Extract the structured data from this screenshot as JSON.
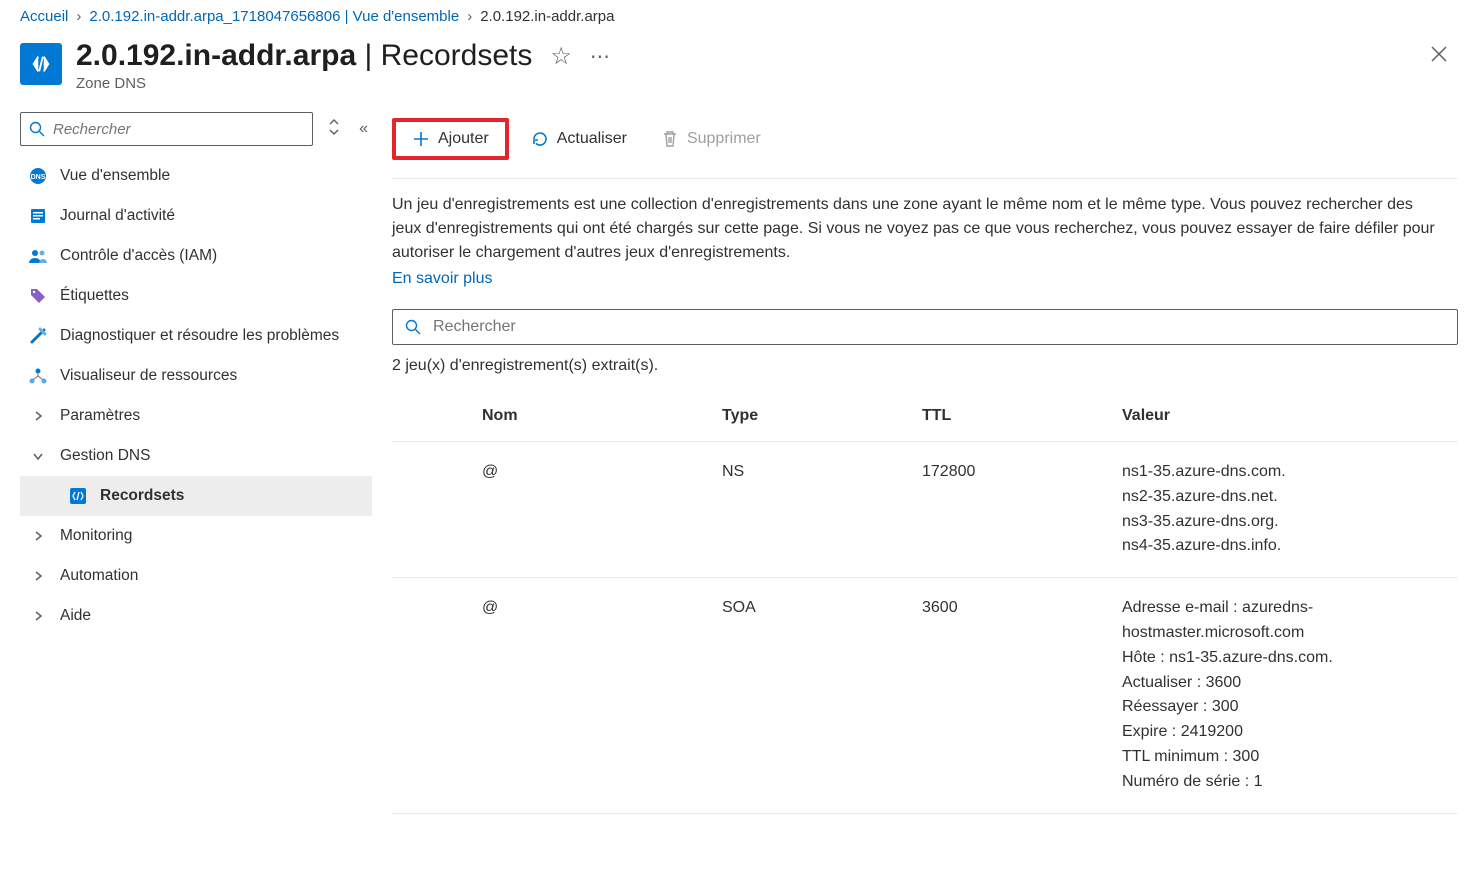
{
  "breadcrumb": {
    "home": "Accueil",
    "parent": "2.0.192.in-addr.arpa_1718047656806 | Vue d'ensemble",
    "current": "2.0.192.in-addr.arpa"
  },
  "header": {
    "title_main": "2.0.192.in-addr.arpa",
    "title_suffix": " | Recordsets",
    "subtitle": "Zone DNS"
  },
  "sidebar": {
    "search_placeholder": "Rechercher",
    "items": {
      "overview": "Vue d'ensemble",
      "activity": "Journal d'activité",
      "iam": "Contrôle d'accès (IAM)",
      "tags": "Étiquettes",
      "diagnose": "Diagnostiquer et résoudre les problèmes",
      "resviz": "Visualiseur de ressources",
      "settings": "Paramètres",
      "dnsmgmt": "Gestion DNS",
      "recordsets": "Recordsets",
      "monitoring": "Monitoring",
      "automation": "Automation",
      "help": "Aide"
    }
  },
  "toolbar": {
    "add": "Ajouter",
    "refresh": "Actualiser",
    "delete": "Supprimer"
  },
  "main": {
    "info_text": "Un jeu d'enregistrements est une collection d'enregistrements dans une zone ayant le même nom et le même type. Vous pouvez rechercher des jeux d'enregistrements qui ont été chargés sur cette page. Si vous ne voyez pas ce que vous recherchez, vous pouvez essayer de faire défiler pour autoriser le chargement d'autres jeux d'enregistrements.",
    "learn_more": "En savoir plus",
    "search_placeholder": "Rechercher",
    "result_count": "2 jeu(x) d'enregistrement(s) extrait(s)."
  },
  "table": {
    "headers": {
      "name": "Nom",
      "type": "Type",
      "ttl": "TTL",
      "value": "Valeur"
    },
    "rows": [
      {
        "name": "@",
        "type": "NS",
        "ttl": "172800",
        "value": [
          "ns1-35.azure-dns.com.",
          "ns2-35.azure-dns.net.",
          "ns3-35.azure-dns.org.",
          "ns4-35.azure-dns.info."
        ]
      },
      {
        "name": "@",
        "type": "SOA",
        "ttl": "3600",
        "value": [
          "Adresse e-mail : azuredns-hostmaster.microsoft.com",
          "Hôte : ns1-35.azure-dns.com.",
          "Actualiser : 3600",
          "Réessayer : 300",
          "Expire : 2419200",
          "TTL minimum : 300",
          "Numéro de série : 1"
        ]
      }
    ]
  }
}
